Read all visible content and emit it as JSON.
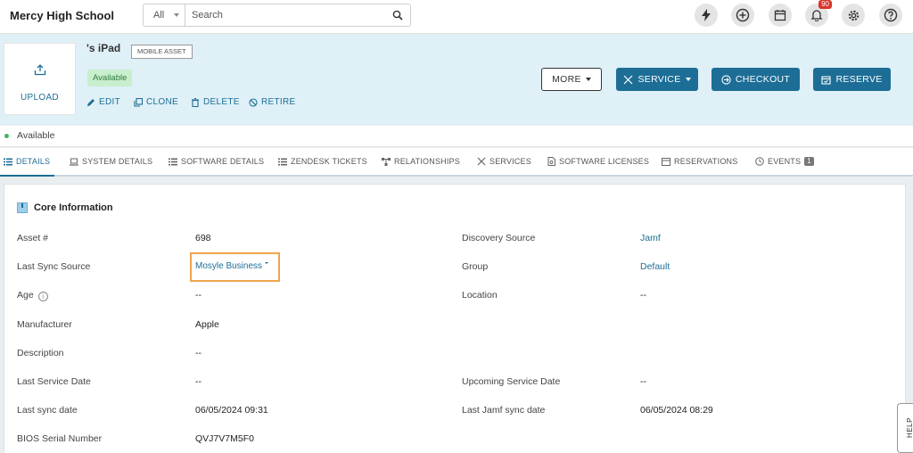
{
  "app": {
    "title": "Mercy High School"
  },
  "search": {
    "scope": "All",
    "placeholder": "Search"
  },
  "toolbar": {
    "notifications_count": "90"
  },
  "asset": {
    "upload_label": "UPLOAD",
    "name": "'s iPad",
    "type_tag": "MOBILE ASSET",
    "status": "Available",
    "actions": {
      "edit": "EDIT",
      "clone": "CLONE",
      "delete": "DELETE",
      "retire": "RETIRE"
    },
    "buttons": {
      "more": "MORE",
      "service": "SERVICE",
      "checkout": "CHECKOUT",
      "reserve": "RESERVE"
    }
  },
  "status_line": {
    "text": "Available"
  },
  "tabs": [
    {
      "label": "DETAILS"
    },
    {
      "label": "SYSTEM DETAILS"
    },
    {
      "label": "SOFTWARE DETAILS"
    },
    {
      "label": "ZENDESK TICKETS"
    },
    {
      "label": "RELATIONSHIPS"
    },
    {
      "label": "SERVICES"
    },
    {
      "label": "SOFTWARE LICENSES"
    },
    {
      "label": "RESERVATIONS"
    },
    {
      "label": "EVENTS",
      "count": "1"
    }
  ],
  "core": {
    "title": "Core Information",
    "left": [
      {
        "label": "Asset #",
        "value": "698"
      },
      {
        "label": "Last Sync Source",
        "value": "Mosyle Business"
      },
      {
        "label": "Age",
        "value": "--"
      },
      {
        "label": "Manufacturer",
        "value": "Apple"
      },
      {
        "label": "Description",
        "value": "--"
      },
      {
        "label": "Last Service Date",
        "value": "--"
      },
      {
        "label": "Last sync date",
        "value": "06/05/2024 09:31"
      },
      {
        "label": "BIOS Serial Number",
        "value": "QVJ7V7M5F0"
      }
    ],
    "right": [
      {
        "label": "Discovery Source",
        "value": "Jamf"
      },
      {
        "label": "Group",
        "value": "Default"
      },
      {
        "label": "Location",
        "value": "--"
      },
      {
        "label": "Upcoming Service Date",
        "value": "--"
      },
      {
        "label": "Last Jamf sync date",
        "value": "06/05/2024 08:29"
      }
    ]
  },
  "help": {
    "label": "HELP"
  },
  "colors": {
    "accent": "#1d6e96",
    "header_bg": "#dff0f7",
    "available": "#3fb45c",
    "highlight": "#f0a44b"
  }
}
